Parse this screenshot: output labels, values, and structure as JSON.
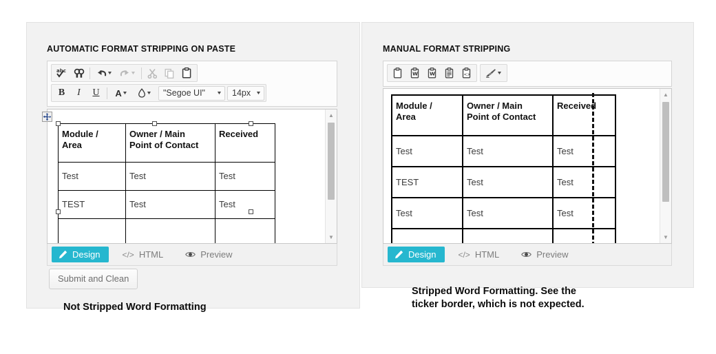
{
  "left_panel": {
    "heading": "AUTOMATIC FORMAT STRIPPING ON PASTE",
    "toolbar_row1": [
      {
        "name": "spellcheck-icon",
        "title": "Spell Check",
        "caret": false
      },
      {
        "name": "find-replace-icon",
        "title": "Find and Replace",
        "caret": false
      },
      {
        "name": "undo-icon",
        "title": "Undo",
        "caret": true,
        "caret_dim": false
      },
      {
        "name": "redo-icon",
        "title": "Redo",
        "caret": true,
        "caret_dim": true,
        "disabled": true
      },
      {
        "name": "cut-icon",
        "title": "Cut",
        "caret": false,
        "disabled": true
      },
      {
        "name": "copy-icon",
        "title": "Copy",
        "caret": false,
        "disabled": true
      },
      {
        "name": "paste-icon",
        "title": "Paste",
        "caret": false
      }
    ],
    "toolbar_row2": [
      {
        "name": "bold-icon",
        "title": "Bold",
        "glyph": "B"
      },
      {
        "name": "italic-icon",
        "title": "Italic",
        "glyph": "I"
      },
      {
        "name": "underline-icon",
        "title": "Underline",
        "glyph": "U"
      },
      {
        "name": "font-color-icon",
        "title": "Font Color",
        "glyph": "A",
        "caret": true
      },
      {
        "name": "highlight-icon",
        "title": "Highlight Color",
        "glyph": "drop",
        "caret": true
      }
    ],
    "font_family_value": "\"Segoe UI\"",
    "font_size_value": "14px",
    "tabs": [
      {
        "label": "Design",
        "icon": "pencil-icon",
        "active": true
      },
      {
        "label": "HTML",
        "icon": "code-icon",
        "active": false
      },
      {
        "label": "Preview",
        "icon": "eye-icon",
        "active": false
      }
    ],
    "submit_label": "Submit and Clean",
    "caption": "Not Stripped Word Formatting",
    "table": {
      "headers": [
        "Module /\nArea",
        "Owner / Main\nPoint of Contact",
        "Received"
      ],
      "rows": [
        [
          "Test",
          "Test",
          "Test"
        ],
        [
          "TEST",
          "Test",
          "Test"
        ],
        [
          "",
          "",
          ""
        ]
      ]
    },
    "scrollbar": {
      "up_glyph": "▲",
      "down_glyph": "▼"
    }
  },
  "right_panel": {
    "heading": "MANUAL FORMAT STRIPPING",
    "toolbar_row1": [
      {
        "name": "paste-icon",
        "title": "Paste"
      },
      {
        "name": "paste-from-word-icon",
        "title": "Paste from Word"
      },
      {
        "name": "paste-from-word-clean-icon",
        "title": "Paste from Word, strip font"
      },
      {
        "name": "paste-plain-text-icon",
        "title": "Paste Plain Text"
      },
      {
        "name": "paste-as-html-icon",
        "title": "Paste as HTML"
      }
    ],
    "toolbar_row1_extra": {
      "name": "format-stripper-icon",
      "title": "Format Stripper",
      "caret": true
    },
    "tabs": [
      {
        "label": "Design",
        "icon": "pencil-icon",
        "active": true
      },
      {
        "label": "HTML",
        "icon": "code-icon",
        "active": false
      },
      {
        "label": "Preview",
        "icon": "eye-icon",
        "active": false
      }
    ],
    "caption": "Stripped Word Formatting. See the\nticker border, which is not expected.",
    "table": {
      "headers": [
        "Module /\nArea",
        "Owner / Main\nPoint of Contact",
        "Received"
      ],
      "rows": [
        [
          "Test",
          "Test",
          "Test"
        ],
        [
          "TEST",
          "Test",
          "Test"
        ],
        [
          "Test",
          "Test",
          "Test"
        ],
        [
          "",
          "",
          ""
        ]
      ]
    },
    "scrollbar": {
      "up_glyph": "▲",
      "down_glyph": "▼"
    }
  },
  "colors": {
    "accent_teal": "#26b7cf",
    "panel_bg": "#f2f2f2",
    "toolbar_bg": "#f4f4f4",
    "page_bg": "#ffffff",
    "table_border": "#000000"
  }
}
